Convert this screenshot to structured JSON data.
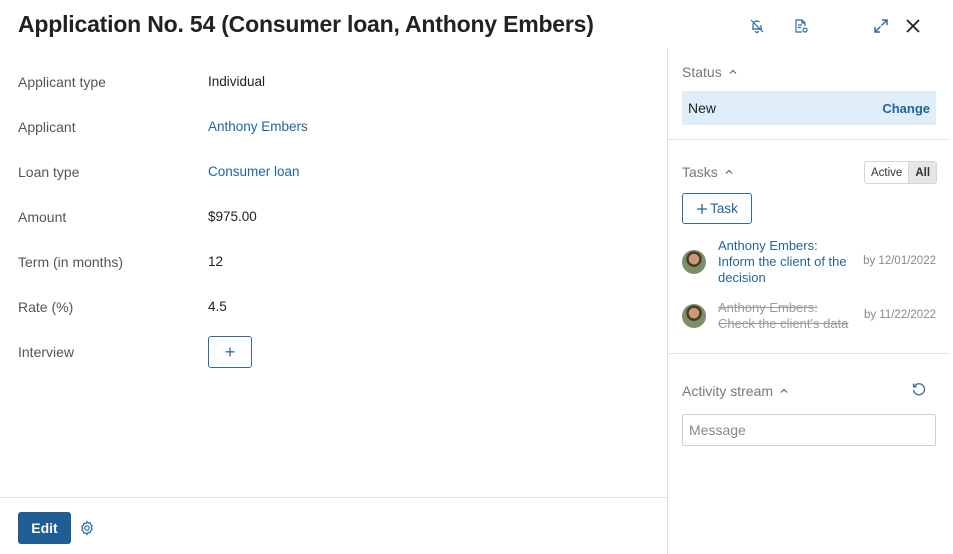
{
  "header": {
    "title": "Application No. 54 (Consumer loan, Anthony Embers)",
    "icons": [
      "bell-off-icon",
      "document-settings-icon",
      "expand-icon",
      "close-icon"
    ]
  },
  "fields": [
    {
      "label": "Applicant type",
      "value": "Individual",
      "link": false
    },
    {
      "label": "Applicant",
      "value": "Anthony Embers",
      "link": true
    },
    {
      "label": "Loan type",
      "value": "Consumer loan",
      "link": true
    },
    {
      "label": "Amount",
      "value": "$975.00",
      "link": false
    },
    {
      "label": "Term (in months)",
      "value": "12",
      "link": false
    },
    {
      "label": "Rate (%)",
      "value": "4.5",
      "link": false
    },
    {
      "label": "Interview",
      "value": "+",
      "link": false
    }
  ],
  "footer": {
    "edit_label": "Edit"
  },
  "status": {
    "title": "Status",
    "value": "New",
    "change_label": "Change"
  },
  "tasks": {
    "title": "Tasks",
    "filters": [
      "Active",
      "All"
    ],
    "selected_filter": "All",
    "add_label": "Task",
    "items": [
      {
        "text": "Anthony Embers: Inform the client of the decision",
        "date": "by 12/01/2022",
        "done": false
      },
      {
        "text": "Anthony Embers: Check the client's data",
        "date": "by 11/22/2022",
        "done": true
      }
    ]
  },
  "activity": {
    "title": "Activity stream",
    "placeholder": "Message"
  },
  "colors": {
    "accent": "#1f5e93",
    "link": "#21659e",
    "status_bg": "#dfeef8"
  }
}
